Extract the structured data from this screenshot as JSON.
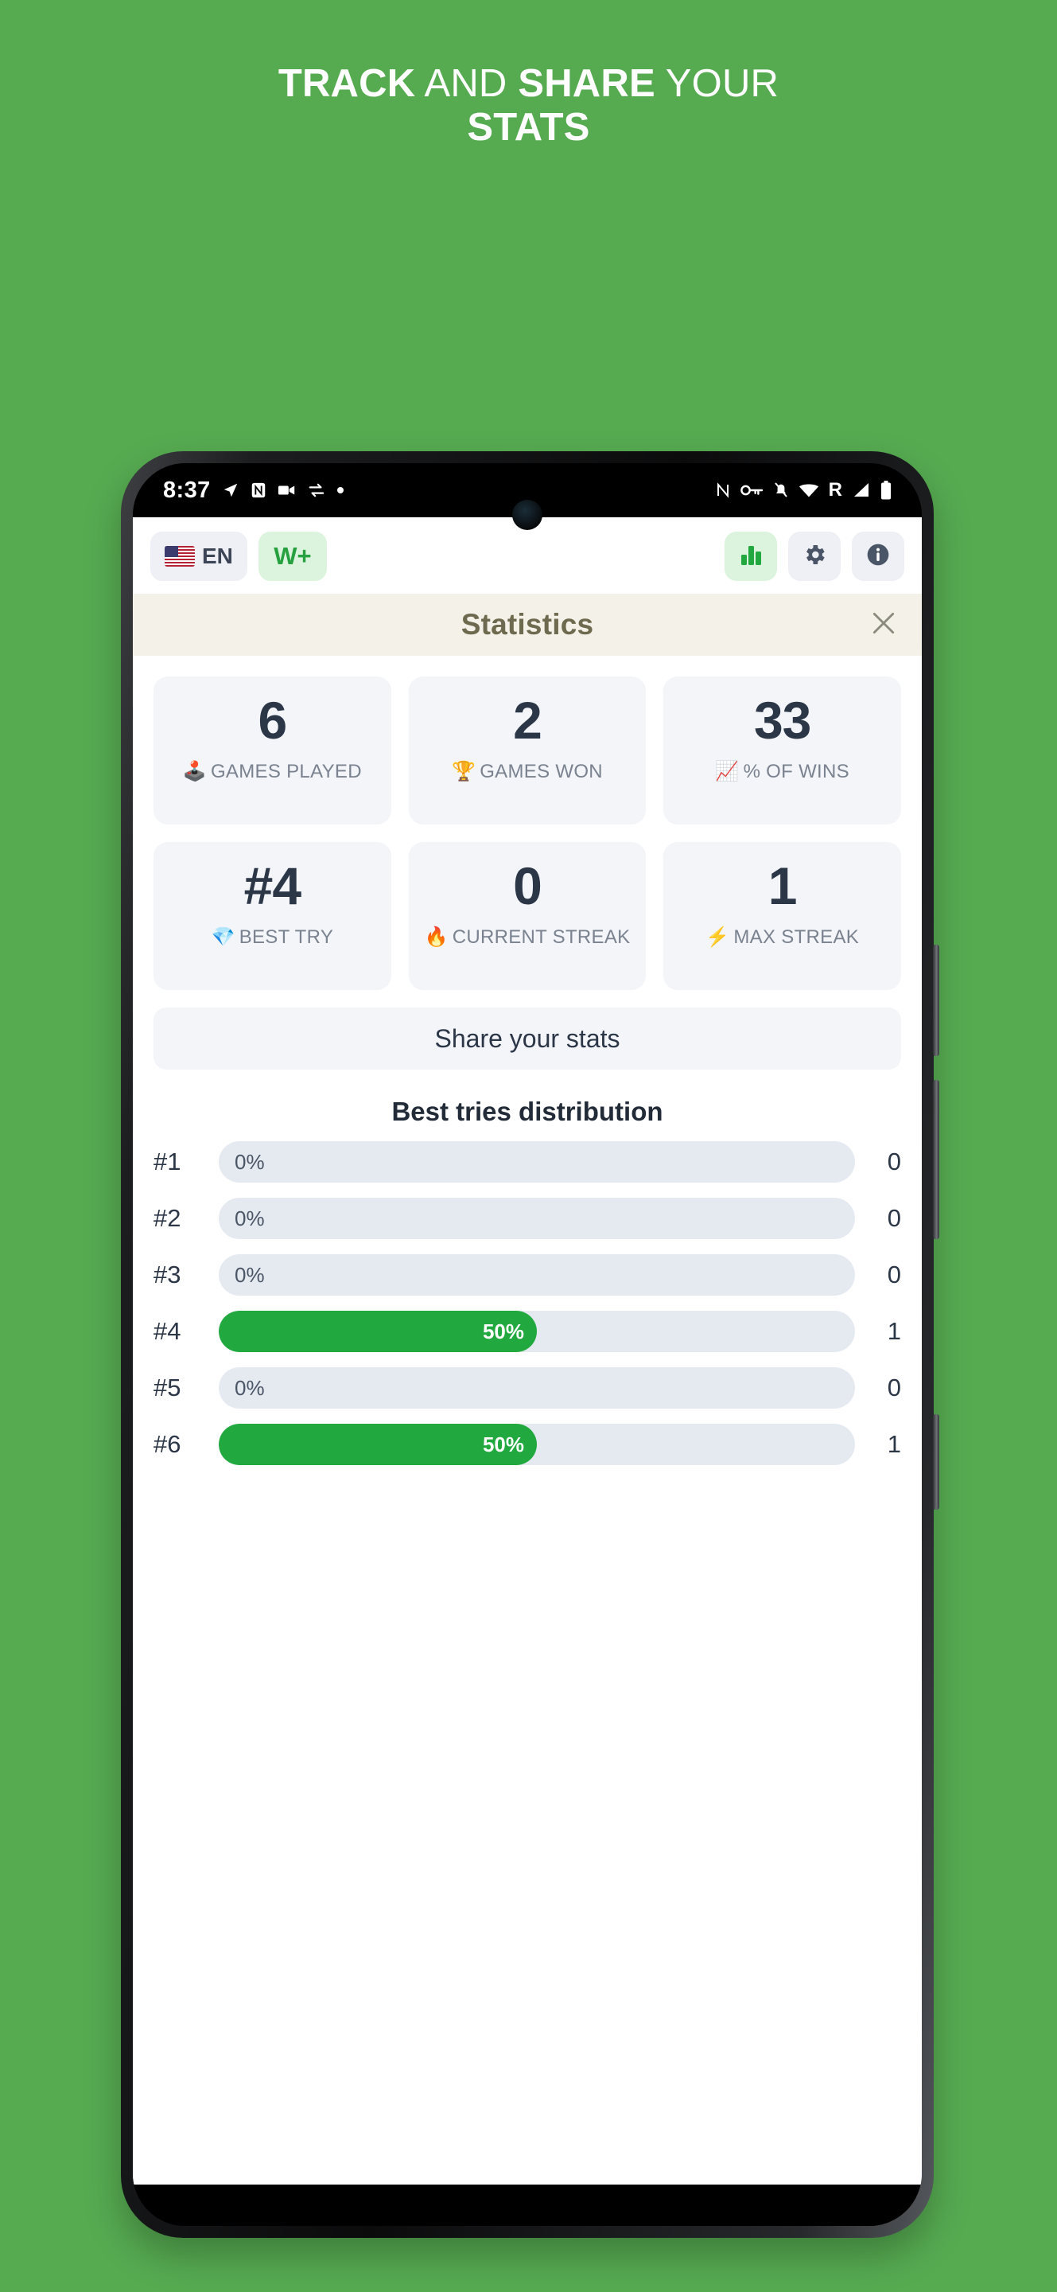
{
  "promo": {
    "line1_part1": "TRACK",
    "line1_part2": " AND ",
    "line1_part3": "SHARE",
    "line1_part4": " YOUR",
    "line2": "STATS"
  },
  "colors": {
    "background": "#56ab51",
    "accent_green": "#21a93f",
    "brand_light_green": "#dcf4de",
    "card_bg": "#f3f5f9",
    "title_bar_bg": "#f4f2e8",
    "title_text": "#6e6a4f",
    "track_bg": "#e5eaf1",
    "value_text": "#2b3647"
  },
  "statusbar": {
    "time": "8:37",
    "left_icons": [
      "location-arrow-icon",
      "nfc-icon",
      "video-camera-icon",
      "sync-icon",
      "dot-icon"
    ],
    "right_icons": [
      "nfc-n-icon",
      "key-icon",
      "bell-off-icon",
      "wifi-icon",
      "roaming-r-icon",
      "cell-signal-icon",
      "battery-icon"
    ]
  },
  "appbar": {
    "language_label": "EN",
    "language_flag": "us-flag-icon",
    "wplus_label": "W+",
    "buttons": [
      {
        "name": "stats-button",
        "icon": "bar-chart-icon"
      },
      {
        "name": "settings-button",
        "icon": "gear-icon"
      },
      {
        "name": "info-button",
        "icon": "info-icon"
      }
    ]
  },
  "modal": {
    "title": "Statistics",
    "close_label": "✕"
  },
  "stats": [
    {
      "value": "6",
      "emoji": "🕹️",
      "label": "GAMES PLAYED",
      "icon": "joystick-icon"
    },
    {
      "value": "2",
      "emoji": "🏆",
      "label": "GAMES WON",
      "icon": "trophy-icon"
    },
    {
      "value": "33",
      "emoji": "📈",
      "label": "% OF WINS",
      "icon": "chart-up-icon"
    },
    {
      "value": "#4",
      "emoji": "💎",
      "label": "BEST TRY",
      "icon": "gem-icon"
    },
    {
      "value": "0",
      "emoji": "🔥",
      "label": "CURRENT STREAK",
      "icon": "fire-icon"
    },
    {
      "value": "1",
      "emoji": "⚡",
      "label": "MAX STREAK",
      "icon": "lightning-icon"
    }
  ],
  "share_button_label": "Share your stats",
  "distribution_title": "Best tries distribution",
  "chart_data": {
    "type": "bar",
    "title": "Best tries distribution",
    "orientation": "horizontal",
    "categories": [
      "#1",
      "#2",
      "#3",
      "#4",
      "#5",
      "#6"
    ],
    "values": [
      0,
      0,
      0,
      50,
      0,
      50
    ],
    "value_labels": [
      "0%",
      "0%",
      "0%",
      "50%",
      "0%",
      "50%"
    ],
    "counts": [
      0,
      0,
      0,
      1,
      0,
      1
    ],
    "count_labels": [
      "0",
      "0",
      "0",
      "1",
      "0",
      "1"
    ],
    "xlabel": "",
    "ylabel": "",
    "xlim": [
      0,
      100
    ],
    "grid": false,
    "legend": "none",
    "bar_color": "#21a93f",
    "track_color": "#e5eaf1"
  }
}
